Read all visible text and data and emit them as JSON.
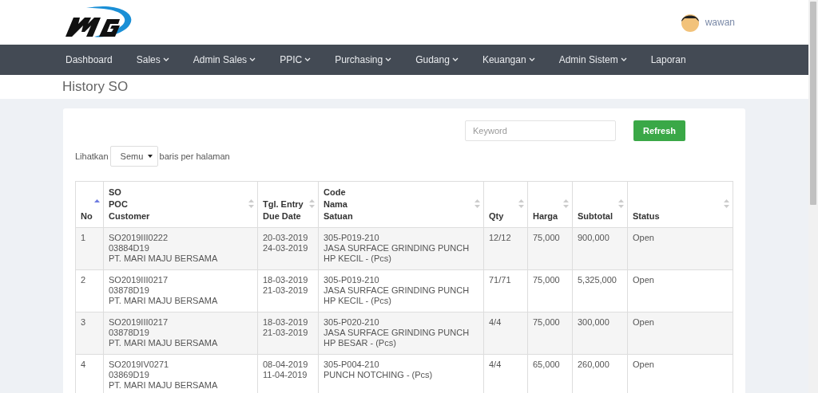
{
  "user": {
    "name": "wawan"
  },
  "nav": [
    {
      "label": "Dashboard",
      "dropdown": false
    },
    {
      "label": "Sales",
      "dropdown": true
    },
    {
      "label": "Admin Sales",
      "dropdown": true
    },
    {
      "label": "PPIC",
      "dropdown": true
    },
    {
      "label": "Purchasing",
      "dropdown": true
    },
    {
      "label": "Gudang",
      "dropdown": true
    },
    {
      "label": "Keuangan",
      "dropdown": true
    },
    {
      "label": "Admin Sistem",
      "dropdown": true
    },
    {
      "label": "Laporan",
      "dropdown": false
    }
  ],
  "page_title": "History SO",
  "search": {
    "placeholder": "Keyword"
  },
  "refresh_button": "Refresh",
  "page_size": {
    "prefix": "Lihatkan",
    "value": "Semu",
    "suffix": "baris per halaman"
  },
  "table": {
    "columns": [
      {
        "lines": [
          "No"
        ],
        "sorted": true
      },
      {
        "lines": [
          "SO",
          "POC",
          "Customer"
        ],
        "sorted": false
      },
      {
        "lines": [
          "Tgl. Entry",
          "Due Date"
        ],
        "sorted": false
      },
      {
        "lines": [
          "Code",
          "Nama",
          "Satuan"
        ],
        "sorted": false
      },
      {
        "lines": [
          "Qty"
        ],
        "sorted": false
      },
      {
        "lines": [
          "Harga"
        ],
        "sorted": false
      },
      {
        "lines": [
          "Subtotal"
        ],
        "sorted": false
      },
      {
        "lines": [
          "Status"
        ],
        "sorted": false
      }
    ],
    "rows": [
      {
        "cells": [
          [
            "1"
          ],
          [
            "SO2019III0222",
            "03884D19",
            "PT. MARI MAJU BERSAMA"
          ],
          [
            "20-03-2019",
            "24-03-2019"
          ],
          [
            "305-P019-210",
            "JASA SURFACE GRINDING PUNCH HP KECIL - (Pcs)"
          ],
          [
            "12/12"
          ],
          [
            "75,000"
          ],
          [
            "900,000"
          ],
          [
            "Open"
          ]
        ]
      },
      {
        "cells": [
          [
            "2"
          ],
          [
            "SO2019III0217",
            "03878D19",
            "PT. MARI MAJU BERSAMA"
          ],
          [
            "18-03-2019",
            "21-03-2019"
          ],
          [
            "305-P019-210",
            "JASA SURFACE GRINDING PUNCH HP KECIL - (Pcs)"
          ],
          [
            "71/71"
          ],
          [
            "75,000"
          ],
          [
            "5,325,000"
          ],
          [
            "Open"
          ]
        ]
      },
      {
        "cells": [
          [
            "3"
          ],
          [
            "SO2019III0217",
            "03878D19",
            "PT. MARI MAJU BERSAMA"
          ],
          [
            "18-03-2019",
            "21-03-2019"
          ],
          [
            "305-P020-210",
            "JASA SURFACE GRINDING PUNCH HP BESAR - (Pcs)"
          ],
          [
            "4/4"
          ],
          [
            "75,000"
          ],
          [
            "300,000"
          ],
          [
            "Open"
          ]
        ]
      },
      {
        "cells": [
          [
            "4"
          ],
          [
            "SO2019IV0271",
            "03869D19",
            "PT. MARI MAJU BERSAMA"
          ],
          [
            "08-04-2019",
            "11-04-2019"
          ],
          [
            "305-P004-210",
            "PUNCH NOTCHING - (Pcs)"
          ],
          [
            "4/4"
          ],
          [
            "65,000"
          ],
          [
            "260,000"
          ],
          [
            "Open"
          ]
        ]
      }
    ]
  }
}
